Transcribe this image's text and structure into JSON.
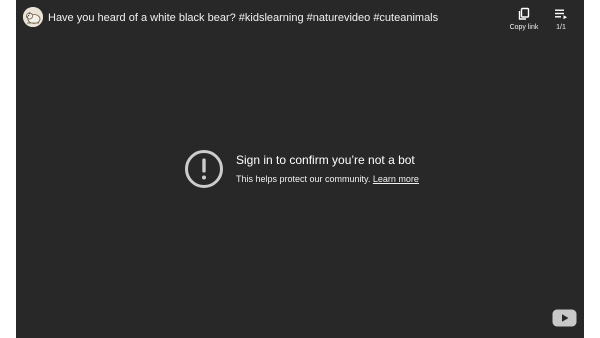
{
  "video": {
    "title": "Have you heard of a white black bear? #kidslearning #naturevideo #cuteanimals"
  },
  "actions": {
    "copy_link_label": "Copy link",
    "playlist_position": "1/1"
  },
  "error": {
    "title": "Sign in to confirm you’re not a bot",
    "message": "This helps protect our community.",
    "link_label": "Learn more"
  },
  "icons": {
    "avatar": "channel-avatar-bear",
    "copy": "copy-icon",
    "playlist": "playlist-icon",
    "warning": "alert-circle-icon",
    "logo": "youtube-logo-icon"
  },
  "colors": {
    "player_bg": "#282828",
    "text": "#ffffff",
    "icon_gray": "#cccccc"
  }
}
